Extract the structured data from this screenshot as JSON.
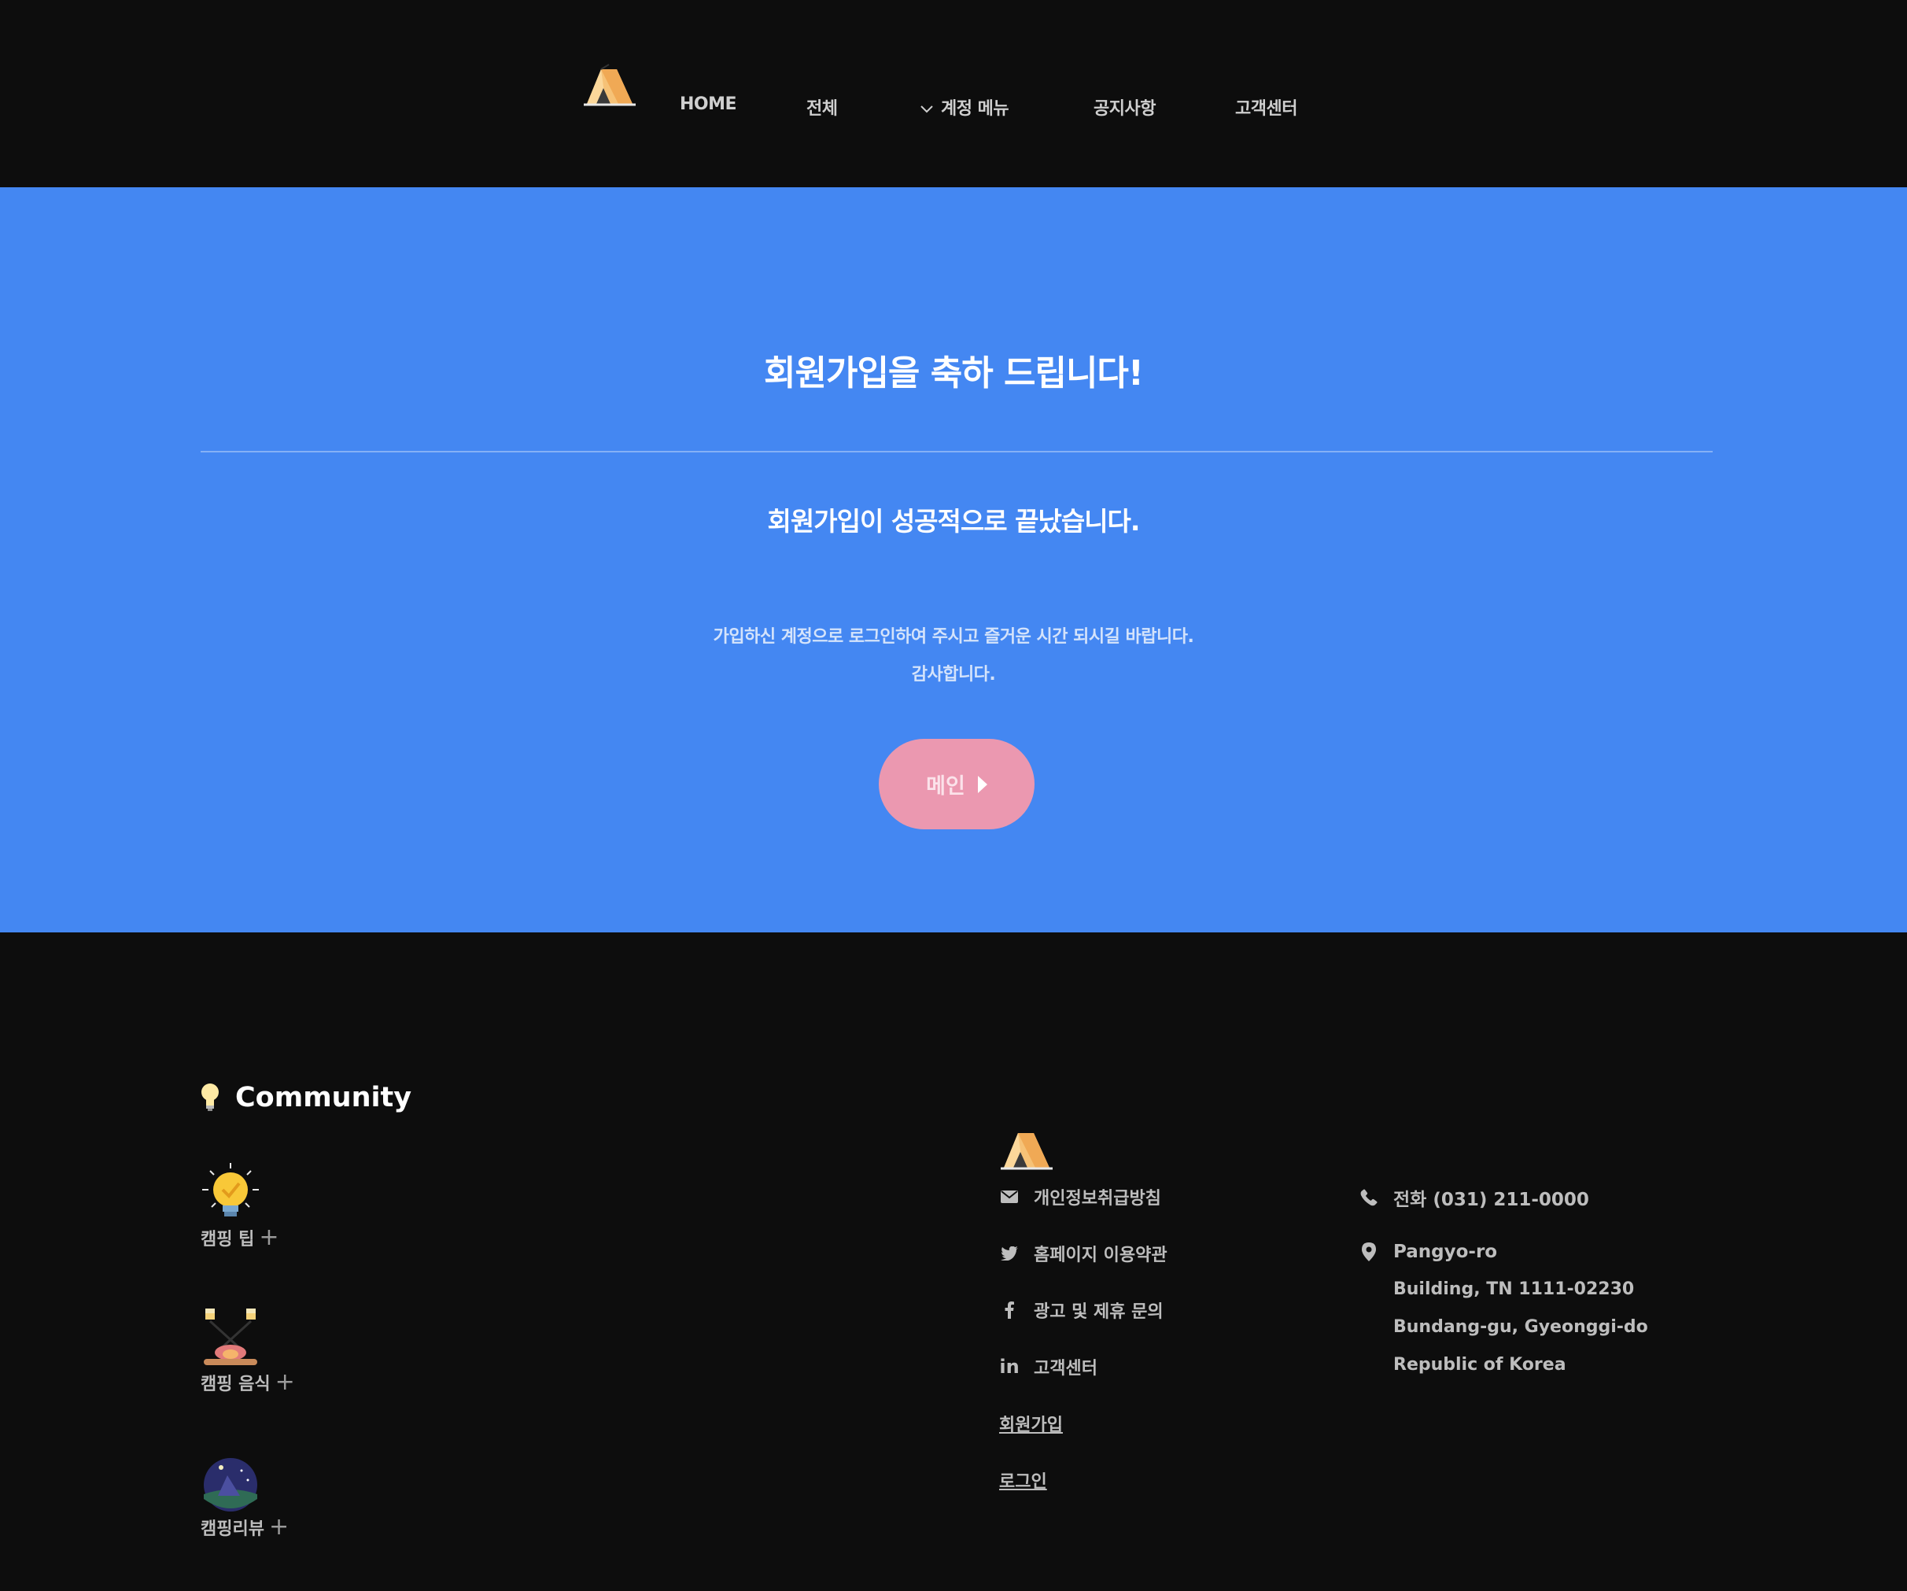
{
  "nav": {
    "home": "HOME",
    "all": "전체",
    "account_menu": "계정 메뉴",
    "notice": "공지사항",
    "support": "고객센터"
  },
  "hero": {
    "title": "회원가입을 축하 드립니다!",
    "subtitle": "회원가입이 성공적으로 끝났습니다.",
    "message_line1": "가입하신 계정으로 로그인하여 주시고 즐거운 시간 되시길 바랍니다.",
    "message_line2": "감사합니다.",
    "main_button": "메인",
    "bg_color": "#4487f2",
    "button_color": "#eb98b0"
  },
  "footer": {
    "community_title": "Community",
    "categories": [
      {
        "label": "캠핑 팁",
        "icon": "lightbulb-icon"
      },
      {
        "label": "캠핑 음식",
        "icon": "campfire-food-icon"
      },
      {
        "label": "캠핑리뷰",
        "icon": "night-tent-icon"
      }
    ],
    "links": {
      "privacy": "개인정보취급방침",
      "terms": "홈페이지 이용약관",
      "ads": "광고 및 제휴 문의",
      "support": "고객센터",
      "signup": "회원가입",
      "login": "로그인"
    },
    "contact": {
      "phone": "전화 (031) 211-0000",
      "address_line1": "Pangyo-ro",
      "address_line2": "Building, TN 1111-02230",
      "address_line3": "Bundang-gu, Gyeonggi-do",
      "address_line4": "Republic of Korea"
    }
  }
}
